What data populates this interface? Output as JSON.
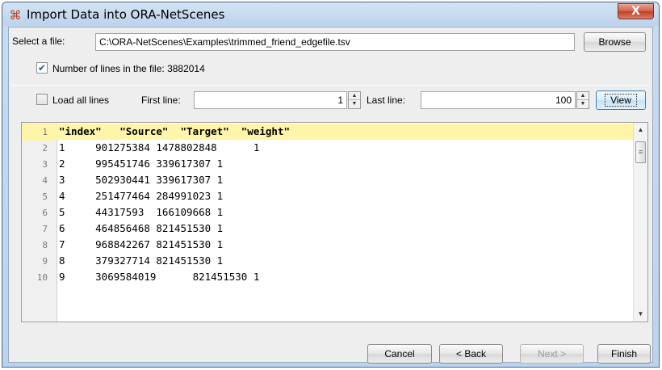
{
  "window": {
    "title": "Import Data into ORA-NetScenes",
    "close_label": "X"
  },
  "file": {
    "label": "Select a file:",
    "path": "C:\\ORA-NetScenes\\Examples\\trimmed_friend_edgefile.tsv",
    "browse_label": "Browse"
  },
  "lines_info": {
    "checked": true,
    "label": "Number of lines in the file: 3882014"
  },
  "range": {
    "load_all_checked": false,
    "load_all_label": "Load all lines",
    "first_label": "First line:",
    "first_value": "1",
    "last_label": "Last line:",
    "last_value": "100",
    "view_label": "View"
  },
  "preview": {
    "lines": [
      {
        "n": "1",
        "text": "\"index\"   \"Source\"  \"Target\"  \"weight\""
      },
      {
        "n": "2",
        "text": "1     901275384 1478802848      1"
      },
      {
        "n": "3",
        "text": "2     995451746 339617307 1"
      },
      {
        "n": "4",
        "text": "3     502930441 339617307 1"
      },
      {
        "n": "5",
        "text": "4     251477464 284991023 1"
      },
      {
        "n": "6",
        "text": "5     44317593  166109668 1"
      },
      {
        "n": "7",
        "text": "6     464856468 821451530 1"
      },
      {
        "n": "8",
        "text": "7     968842267 821451530 1"
      },
      {
        "n": "9",
        "text": "8     379327714 821451530 1"
      },
      {
        "n": "10",
        "text": "9     3069584019      821451530 1"
      }
    ]
  },
  "footer": {
    "cancel_label": "Cancel",
    "back_label": "< Back",
    "next_label": "Next >",
    "finish_label": "Finish"
  },
  "icons": {
    "app": "ora-netscenes-icon",
    "check": "checkmark-icon",
    "spin_up": "spinner-up-icon",
    "spin_down": "spinner-down-icon"
  }
}
